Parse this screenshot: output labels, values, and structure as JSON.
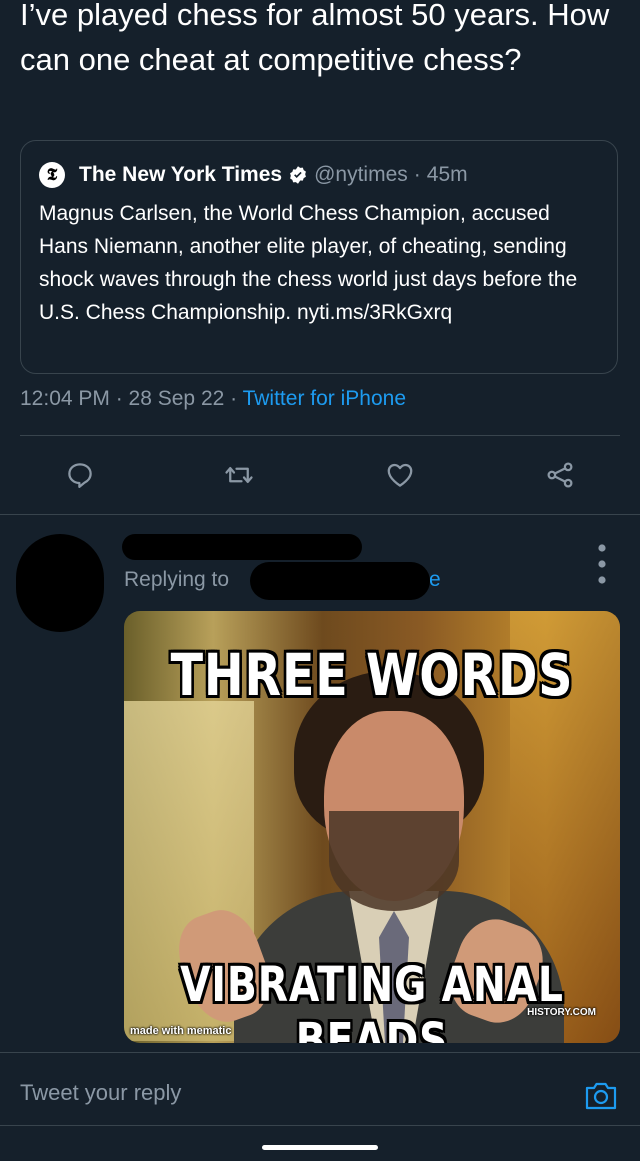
{
  "tweet": {
    "text": "I’ve played chess for almost 50 years. How can one cheat at competitive chess?",
    "timestamp": "12:04 PM · 28 Sep 22 · ",
    "source": "Twitter for iPhone"
  },
  "quoted_tweet": {
    "logo_letter": "𝕿",
    "author_name": "The New York Times",
    "handle": "@nytimes",
    "separator": "·",
    "time": "45m",
    "body": "Magnus Carlsen, the World Chess Champion, accused Hans Niemann, another elite player, of cheating, sending shock waves through the chess world just days before the U.S. Chess Championship. nyti.ms/3RkGxrq"
  },
  "actions": {
    "reply_icon": "reply-icon",
    "retweet_icon": "retweet-icon",
    "like_icon": "heart-icon",
    "share_icon": "share-icon"
  },
  "reply": {
    "replying_to_label": "Replying to",
    "handle_tail": "e",
    "meme": {
      "top_text": "THREE WORDS",
      "bottom_text": "VIBRATING ANAL BEADS",
      "credit": "made with mematic",
      "watermark": "HISTORY.COM"
    }
  },
  "composer": {
    "placeholder": "Tweet your reply"
  },
  "colors": {
    "background": "#15202b",
    "border": "#38444d",
    "secondary_text": "#8b98a5",
    "accent": "#1d9bf0"
  }
}
